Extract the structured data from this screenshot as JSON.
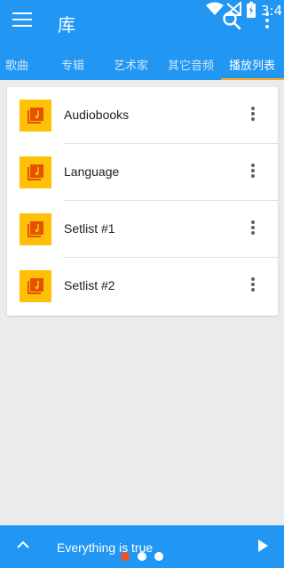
{
  "status": {
    "time": "3:4"
  },
  "appbar": {
    "title": "库"
  },
  "tabs": [
    {
      "label": "歌曲"
    },
    {
      "label": "专辑"
    },
    {
      "label": "艺术家"
    },
    {
      "label": "其它音频"
    },
    {
      "label": "播放列表",
      "active": true
    }
  ],
  "playlists": [
    {
      "name": "Audiobooks"
    },
    {
      "name": "Language"
    },
    {
      "name": "Setlist #1"
    },
    {
      "name": "Setlist #2"
    }
  ],
  "player": {
    "track": "Everything is true"
  },
  "colors": {
    "primary": "#2196f3",
    "accent": "#f9a825",
    "thumb": "#ffc107",
    "thumb_icon": "#e65100",
    "page_dot_active": "#f4511e"
  },
  "icons": {
    "menu": "menu-icon",
    "search": "search-icon",
    "overflow": "overflow-icon",
    "playlist": "playlist-music-icon",
    "expand": "chevron-up-icon",
    "play": "play-icon"
  }
}
